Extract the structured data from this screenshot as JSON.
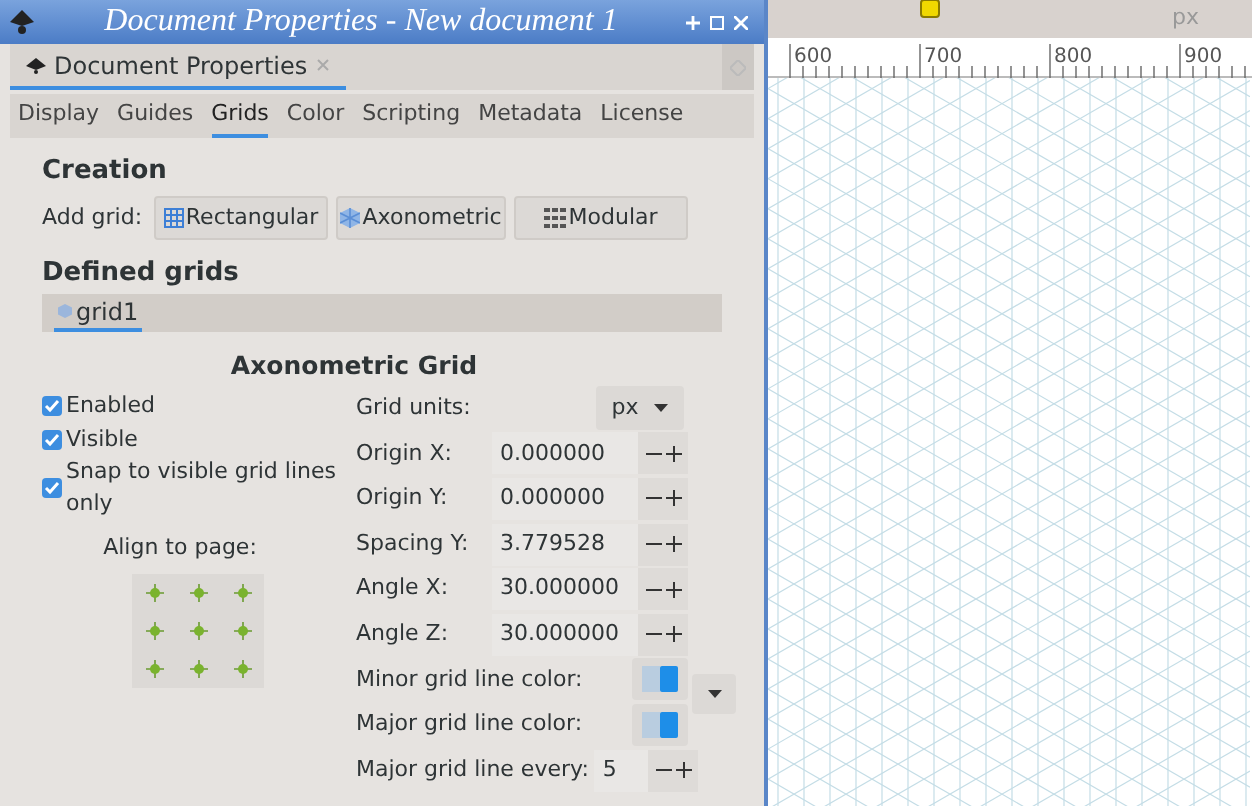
{
  "window": {
    "title": "Document Properties - New document 1"
  },
  "dock_tab": {
    "label": "Document Properties",
    "selected": true
  },
  "tabs": [
    {
      "label": "Display",
      "selected": false
    },
    {
      "label": "Guides",
      "selected": false
    },
    {
      "label": "Grids",
      "selected": true
    },
    {
      "label": "Color",
      "selected": false
    },
    {
      "label": "Scripting",
      "selected": false
    },
    {
      "label": "Metadata",
      "selected": false
    },
    {
      "label": "License",
      "selected": false
    }
  ],
  "creation": {
    "heading": "Creation",
    "label": "Add grid:",
    "buttons": [
      {
        "label": "Rectangular",
        "kind": "rect"
      },
      {
        "label": "Axonometric",
        "kind": "axo"
      },
      {
        "label": "Modular",
        "kind": "modular"
      }
    ]
  },
  "defined_grids": {
    "heading": "Defined grids",
    "tabs": [
      {
        "label": "grid1",
        "selected": true
      }
    ]
  },
  "grid": {
    "title": "Axonometric Grid",
    "options": [
      {
        "label": "Enabled",
        "checked": true
      },
      {
        "label": "Visible",
        "checked": true
      },
      {
        "label": "Snap to visible grid lines only",
        "checked": true
      }
    ],
    "align_label": "Align to page:",
    "fields": [
      {
        "kind": "dropdown",
        "label": "Grid units:",
        "value": "px"
      },
      {
        "kind": "spin",
        "label": "Origin X:",
        "value": "0.000000"
      },
      {
        "kind": "spin",
        "label": "Origin Y:",
        "value": "0.000000"
      },
      {
        "kind": "spin",
        "label": "Spacing Y:",
        "value": "3.779528"
      },
      {
        "kind": "spin",
        "label": "Angle X:",
        "value": "30.000000"
      },
      {
        "kind": "spin",
        "label": "Angle Z:",
        "value": "30.000000"
      },
      {
        "kind": "color",
        "label": "Minor grid line color:"
      },
      {
        "kind": "color",
        "label": "Major grid line color:"
      },
      {
        "kind": "spin",
        "label": "Major grid line every:",
        "value": "5"
      }
    ]
  },
  "canvas": {
    "unit": "px",
    "ruler": [
      "600",
      "700",
      "800",
      "900"
    ]
  }
}
